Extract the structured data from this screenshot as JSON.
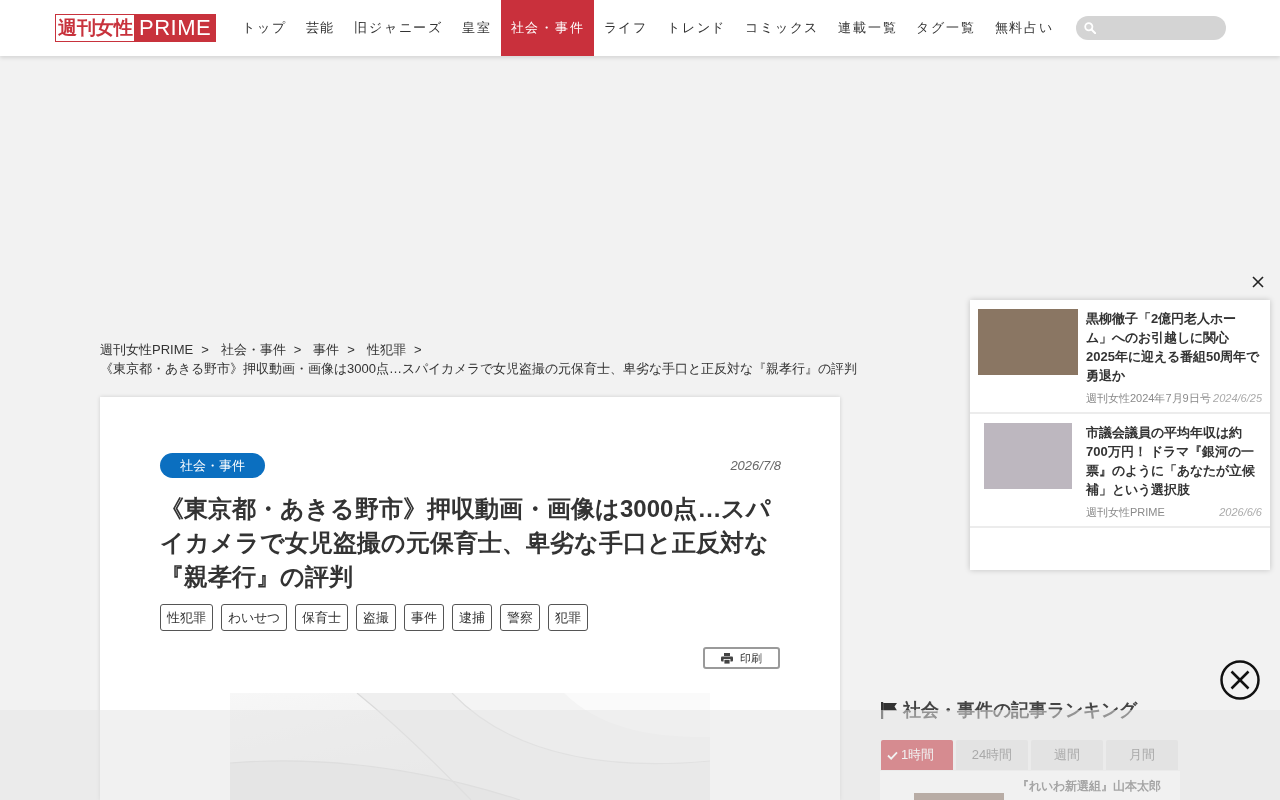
{
  "header": {
    "logo": {
      "mark": "週刊女性",
      "wordmark": "PRIME"
    },
    "nav": [
      {
        "label": "トップ",
        "selected": false
      },
      {
        "label": "芸能",
        "selected": false
      },
      {
        "label": "旧ジャニーズ",
        "selected": false
      },
      {
        "label": "皇室",
        "selected": false
      },
      {
        "label": "社会・事件",
        "selected": true
      },
      {
        "label": "ライフ",
        "selected": false
      },
      {
        "label": "トレンド",
        "selected": false
      },
      {
        "label": "コミックス",
        "selected": false
      },
      {
        "label": "連載一覧",
        "selected": false
      },
      {
        "label": "タグ一覧",
        "selected": false
      },
      {
        "label": "無料占い",
        "selected": false
      }
    ]
  },
  "breadcrumb": {
    "items": [
      {
        "label": "週刊女性PRIME",
        "separator": ">"
      },
      {
        "label": "社会・事件",
        "separator": ">"
      },
      {
        "label": "事件",
        "separator": ">"
      },
      {
        "label": "性犯罪",
        "separator": ">"
      }
    ],
    "current": "《東京都・あきる野市》押収動画・画像は3000点…スパイカメラで女児盗撮の元保育士、卑劣な手口と正反対な『親孝行』の評判"
  },
  "article": {
    "category": "社会・事件",
    "date": "2026/7/8",
    "title": "《東京都・あきる野市》押収動画・画像は3000点…スパイカメラで女児盗撮の元保育士、卑劣な手口と正反対な『親孝行』の評判",
    "tags": [
      "性犯罪",
      "わいせつ",
      "保育士",
      "盗撮",
      "事件",
      "逮捕",
      "警察",
      "犯罪"
    ],
    "print_label": "印刷"
  },
  "recommend_popup": {
    "items": [
      {
        "title": "黒柳徹子「2億円老人ホーム」へのお引越しに関心 2025年に迎える番組50周年で勇退か",
        "source": "週刊女性2024年7月9日号",
        "date": "2024/6/25"
      },
      {
        "title": "市議会議員の平均年収は約700万円！ ドラマ『銀河の一票』のように「あなたが立候補」という選択肢",
        "source": "週刊女性PRIME",
        "date": "2026/6/6"
      }
    ]
  },
  "ranking": {
    "heading": "社会・事件の記事ランキング",
    "tabs": [
      {
        "label": "1時間",
        "selected": true
      },
      {
        "label": "24時間",
        "selected": false
      },
      {
        "label": "週間",
        "selected": false
      },
      {
        "label": "月間",
        "selected": false
      }
    ],
    "items": [
      {
        "title": "『れいわ新選組』山本太郎"
      }
    ]
  }
}
